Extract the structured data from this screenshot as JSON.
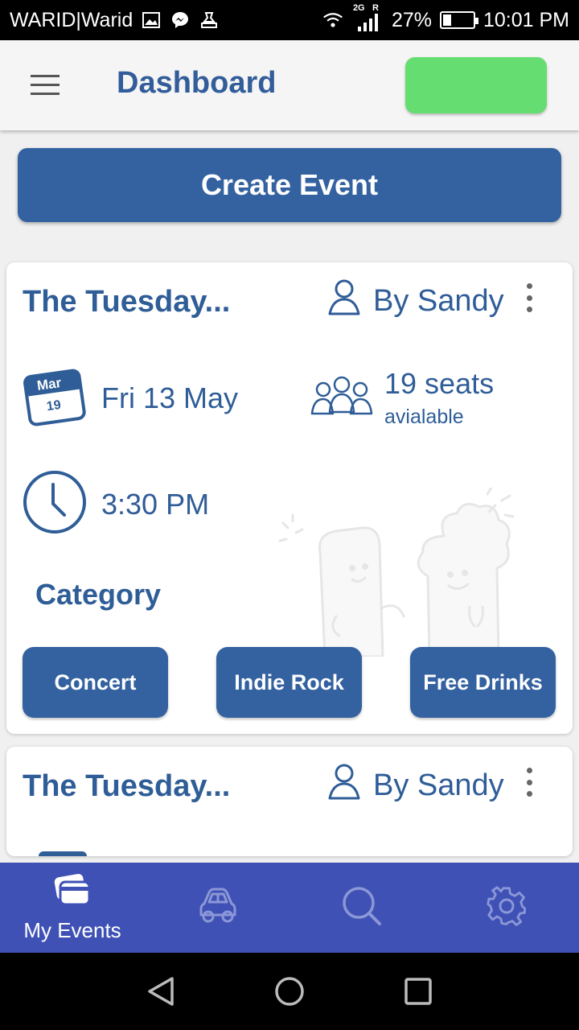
{
  "status_bar": {
    "carrier": "WARID|Warid",
    "network": "2G",
    "roaming": "R",
    "battery": "27%",
    "battery_level": 0.27,
    "time": "10:01 PM",
    "icons": [
      "gallery-icon",
      "messenger-icon",
      "notification-icon",
      "wifi-icon",
      "signal-icon",
      "battery-icon"
    ]
  },
  "header": {
    "title": "Dashboard",
    "menu_icon": "hamburger-icon",
    "action_color": "#66dd70"
  },
  "create_event": {
    "label": "Create Event"
  },
  "events": [
    {
      "title": "The Tuesday...",
      "organizer": "By Sandy",
      "calendar_icon": {
        "month": "Mar",
        "day": "19"
      },
      "date": "Fri 13 May",
      "seats_count": "19 seats",
      "seats_label": "avialable",
      "time": "3:30 PM",
      "category_label": "Category",
      "categories": [
        "Concert",
        "Indie Rock",
        "Free Drinks"
      ]
    },
    {
      "title": "The Tuesday...",
      "organizer": "By Sandy"
    }
  ],
  "bottom_nav": [
    {
      "label": "My Events",
      "icon": "tickets-icon",
      "active": true
    },
    {
      "label": "",
      "icon": "car-icon",
      "active": false
    },
    {
      "label": "",
      "icon": "search-icon",
      "active": false
    },
    {
      "label": "",
      "icon": "settings-gear-icon",
      "active": false
    }
  ],
  "system_nav": [
    "back-icon",
    "home-icon",
    "recents-icon"
  ],
  "colors": {
    "primary": "#3462a0",
    "text_primary": "#2f5d97",
    "nav_bg": "#3f51b5",
    "accent_green": "#66dd70"
  }
}
